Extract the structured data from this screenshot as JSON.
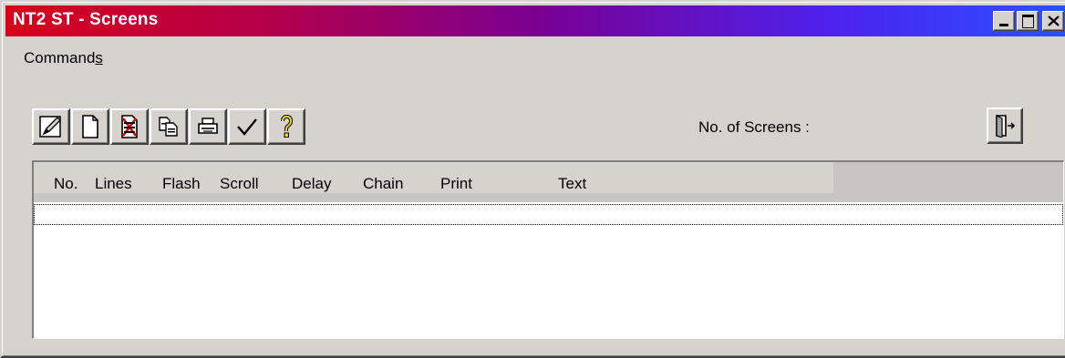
{
  "window": {
    "title": "NT2 ST - Screens",
    "controls": [
      "minimize",
      "maximize",
      "close"
    ]
  },
  "menu": {
    "commands_prefix": "Command",
    "commands_mnemonic": "s"
  },
  "toolbar": {
    "buttons": [
      {
        "icon": "edit-pencil-icon"
      },
      {
        "icon": "new-page-icon"
      },
      {
        "icon": "delete-page-icon"
      },
      {
        "icon": "copy-icon"
      },
      {
        "icon": "print-icon"
      },
      {
        "icon": "check-icon"
      },
      {
        "icon": "help-icon"
      }
    ]
  },
  "screens": {
    "count_label": "No. of Screens :",
    "count_value": ""
  },
  "exit_button": {
    "icon": "exit-door-icon"
  },
  "table": {
    "columns": [
      "No.",
      "Lines",
      "Flash",
      "Scroll",
      "Delay",
      "Chain",
      "Print",
      "Text"
    ],
    "rows": []
  },
  "colors": {
    "title_gradient_start": "#d8001a",
    "title_gradient_end": "#2a50ff",
    "face": "#d6d3ce"
  }
}
